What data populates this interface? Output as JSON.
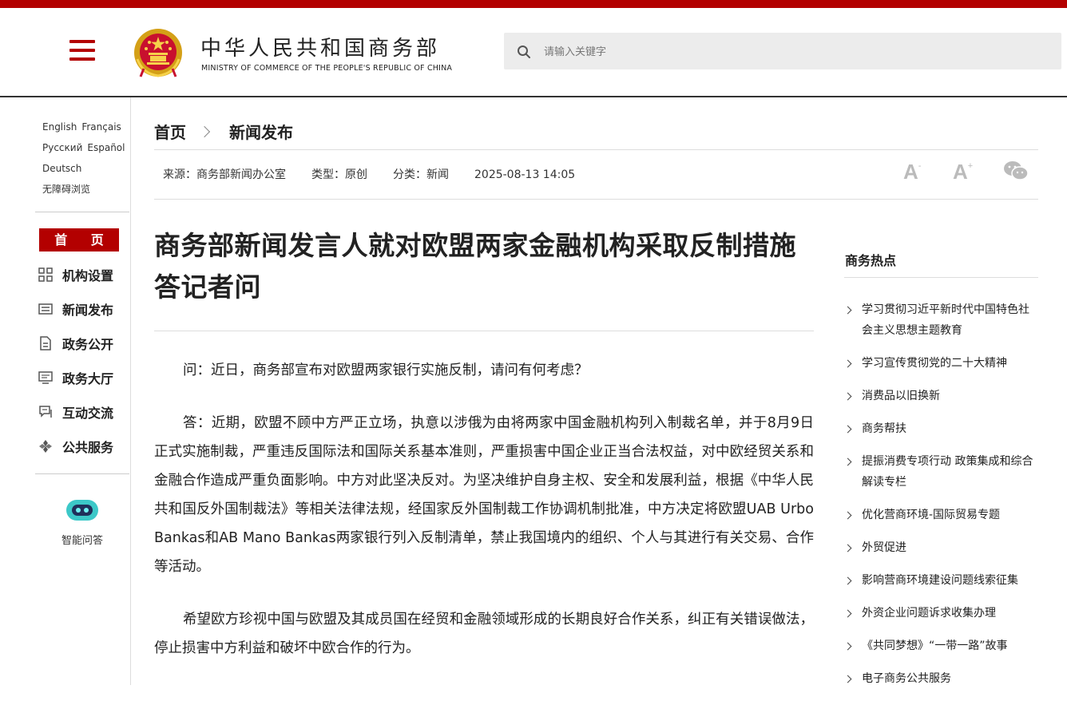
{
  "header": {
    "title": "中华人民共和国商务部",
    "subtitle": "MINISTRY OF COMMERCE OF THE PEOPLE'S REPUBLIC OF CHINA",
    "search_placeholder": "请输入关键字",
    "brand_color": "#b30000"
  },
  "sidebar": {
    "languages": [
      "English",
      "Français",
      "Русский",
      "Español",
      "Deutsch",
      "无障碍浏览"
    ],
    "home": "首 页",
    "items": [
      {
        "label": "机构设置",
        "icon": "grid-icon"
      },
      {
        "label": "新闻发布",
        "icon": "news-icon"
      },
      {
        "label": "政务公开",
        "icon": "document-icon"
      },
      {
        "label": "政务大厅",
        "icon": "monitor-icon"
      },
      {
        "label": "互动交流",
        "icon": "chat-icon"
      },
      {
        "label": "公共服务",
        "icon": "service-icon"
      }
    ],
    "assistant_label": "智能问答"
  },
  "breadcrumb": {
    "home": "首页",
    "current": "新闻发布"
  },
  "meta": {
    "source": "来源：商务部新闻办公室",
    "type": "类型：原创",
    "category": "分类：新闻",
    "datetime": "2025-08-13 14:05"
  },
  "tools": {
    "font_decrease": "A",
    "font_increase": "A",
    "minus": "-",
    "plus": "+"
  },
  "article": {
    "title": "商务部新闻发言人就对欧盟两家金融机构采取反制措施答记者问",
    "paragraphs": [
      "问：近日，商务部宣布对欧盟两家银行实施反制，请问有何考虑？",
      "答：近期，欧盟不顾中方严正立场，执意以涉俄为由将两家中国金融机构列入制裁名单，并于8月9日正式实施制裁，严重违反国际法和国际关系基本准则，严重损害中国企业正当合法权益，对中欧经贸关系和金融合作造成严重负面影响。中方对此坚决反对。为坚决维护自身主权、安全和发展利益，根据《中华人民共和国反外国制裁法》等相关法律法规，经国家反外国制裁工作协调机制批准，中方决定将欧盟UAB Urbo Bankas和AB Mano Bankas两家银行列入反制清单，禁止我国境内的组织、个人与其进行有关交易、合作等活动。",
      "希望欧方珍视中国与欧盟及其成员国在经贸和金融领域形成的长期良好合作关系，纠正有关错误做法，停止损害中方利益和破坏中欧合作的行为。"
    ]
  },
  "hot": {
    "title": "商务热点",
    "items": [
      "学习贯彻习近平新时代中国特色社会主义思想主题教育",
      "学习宣传贯彻党的二十大精神",
      "消费品以旧换新",
      "商务帮扶",
      "提振消费专项行动 政策集成和综合解读专栏",
      "优化营商环境-国际贸易专题",
      "外贸促进",
      "影响营商环境建设问题线索征集",
      "外资企业问题诉求收集办理",
      "《共同梦想》“一带一路”故事",
      "电子商务公共服务"
    ]
  }
}
